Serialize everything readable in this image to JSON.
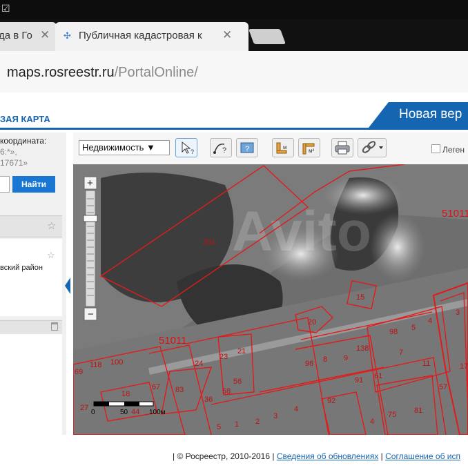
{
  "os": {
    "icon": "clipboard-check-icon"
  },
  "tabs": [
    {
      "label": "да в Го",
      "close": "✕"
    },
    {
      "label": "Публичная кадастровая к",
      "close": "✕"
    }
  ],
  "address": {
    "host": "maps.rosreestr.ru",
    "path": "/PortalOnline/"
  },
  "header": {
    "map_title": "ЗАЯ КАРТА",
    "new_version": "Новая вер"
  },
  "left_panel": {
    "coord_line1": "координата:",
    "coord_line2": "6:*»,",
    "coord_line3": "17671»",
    "find_button": "Найти",
    "district": "вский район"
  },
  "toolbar": {
    "layer_select": "Недвижимость ▼",
    "legend": "Леген"
  },
  "map": {
    "quarter_labels": [
      "51011",
      "51011"
    ],
    "parcel_labels": [
      "201",
      "15",
      "20",
      "5",
      "4",
      "3",
      "98",
      "9",
      "138",
      "96",
      "8",
      "7",
      "61",
      "11",
      "57",
      "17",
      "100",
      "118",
      "69",
      "24",
      "23",
      "21",
      "83",
      "18",
      "67",
      "56",
      "36",
      "58",
      "91",
      "92",
      "81",
      "75",
      "4",
      "3",
      "2",
      "1",
      "5",
      "27",
      "44",
      "4"
    ],
    "scale": {
      "zero": "0",
      "mid": "50",
      "end": "100м"
    },
    "watermark": "Avito"
  },
  "footer": {
    "copyright": "| © Росреестр, 2010-2016 |",
    "link1": "Сведения об обновлениях",
    "sep": " | ",
    "link2": "Соглашение об исп"
  }
}
